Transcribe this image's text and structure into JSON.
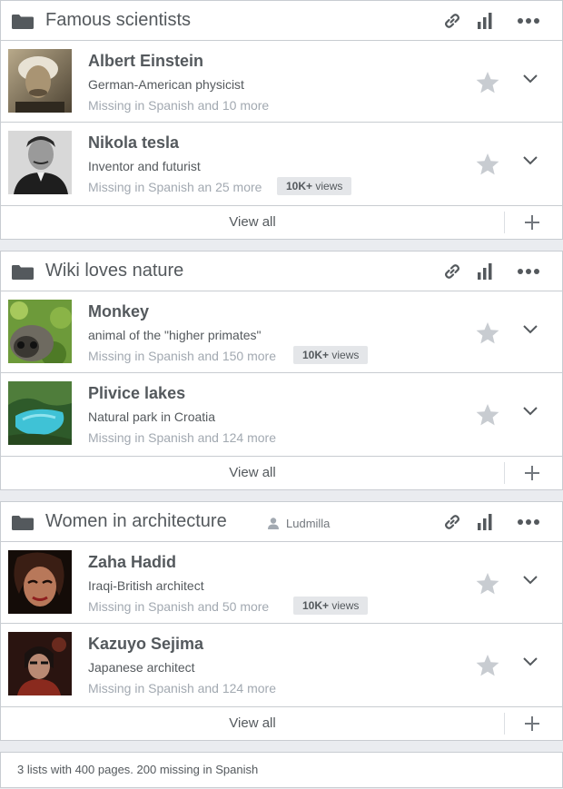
{
  "lists": [
    {
      "title": "Famous scientists",
      "owner": "",
      "items": [
        {
          "title": "Albert Einstein",
          "description": "German-American physicist",
          "missing": "Missing in Spanish and 10 more",
          "views": ""
        },
        {
          "title": "Nikola tesla",
          "description": "Inventor and futurist",
          "missing": "Missing in Spanish an 25 more",
          "views": "views"
        }
      ],
      "view_all": "View all"
    },
    {
      "title": "Wiki loves nature",
      "owner": "",
      "items": [
        {
          "title": "Monkey",
          "description": "animal of the \"higher primates\"",
          "missing": "Missing in Spanish and 150 more",
          "views": "views"
        },
        {
          "title": "Plivice lakes",
          "description": "Natural park in Croatia",
          "missing": "Missing in Spanish and 124 more",
          "views": ""
        }
      ],
      "view_all": "View all"
    },
    {
      "title": "Women in architecture",
      "owner": "Ludmilla",
      "items": [
        {
          "title": "Zaha Hadid",
          "description": "Iraqi-British architect",
          "missing": "Missing in Spanish and 50 more",
          "views": "views"
        },
        {
          "title": "Kazuyo Sejima",
          "description": "Japanese architect",
          "missing": "Missing in Spanish and 124 more",
          "views": ""
        }
      ],
      "view_all": "View all"
    }
  ],
  "views_count": "10K+",
  "summary": "3 lists with 400 pages. 200 missing in Spanish",
  "colors": {
    "icon": "#54595d",
    "star": "#c8ccd1",
    "badge": "#e4e6e9",
    "muted": "#a2a9b1"
  }
}
